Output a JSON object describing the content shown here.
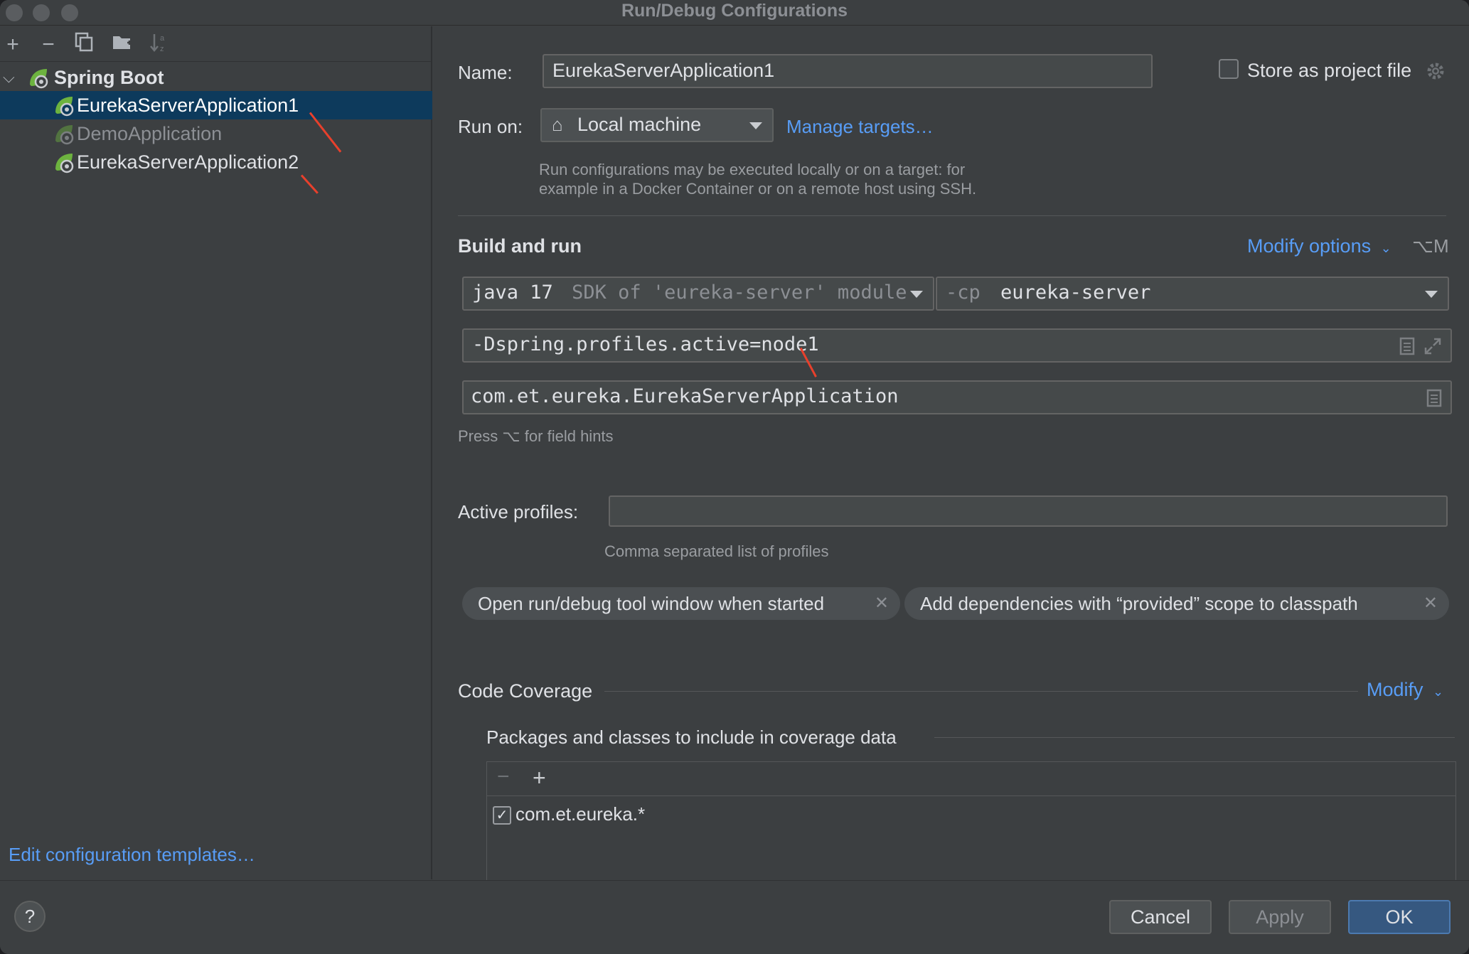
{
  "window": {
    "title": "Run/Debug Configurations"
  },
  "sidebar": {
    "group_label": "Spring Boot",
    "items": [
      {
        "label": "EurekaServerApplication1",
        "selected": true
      },
      {
        "label": "DemoApplication",
        "selected": false
      },
      {
        "label": "EurekaServerApplication2",
        "selected": false
      }
    ],
    "edit_templates_link": "Edit configuration templates…"
  },
  "form": {
    "name_label": "Name:",
    "name_value": "EurekaServerApplication1",
    "store_as_project_file": "Store as project file",
    "run_on_label": "Run on:",
    "run_on_value": "Local machine",
    "manage_targets": "Manage targets…",
    "run_on_hint_1": "Run configurations may be executed locally or on a target: for",
    "run_on_hint_2": "example in a Docker Container or on a remote host using SSH."
  },
  "build_and_run": {
    "title": "Build and run",
    "modify_options": "Modify options",
    "shortcut": "⌥M",
    "sdk_main": "java 17",
    "sdk_detail": "SDK of 'eureka-server' module",
    "cp_flag": "-cp",
    "cp_value": "eureka-server",
    "vm_options": "-Dspring.profiles.active=node1",
    "main_class": "com.et.eureka.EurekaServerApplication",
    "field_hints": "Press ⌥ for field hints",
    "active_profiles_label": "Active profiles:",
    "active_profiles_value": "",
    "active_profiles_hint": "Comma separated list of profiles",
    "chips": [
      "Open run/debug tool window when started",
      "Add dependencies with “provided” scope to classpath"
    ]
  },
  "code_coverage": {
    "title": "Code Coverage",
    "modify": "Modify",
    "packages_title": "Packages and classes to include in coverage data",
    "entries": [
      {
        "label": "com.et.eureka.*",
        "checked": true
      }
    ]
  },
  "footer": {
    "help": "?",
    "cancel": "Cancel",
    "apply": "Apply",
    "ok": "OK"
  },
  "colors": {
    "accent": "#589df6",
    "selection": "#0d3a5c",
    "annotation": "#e8402c",
    "spring": "#6db33f"
  }
}
